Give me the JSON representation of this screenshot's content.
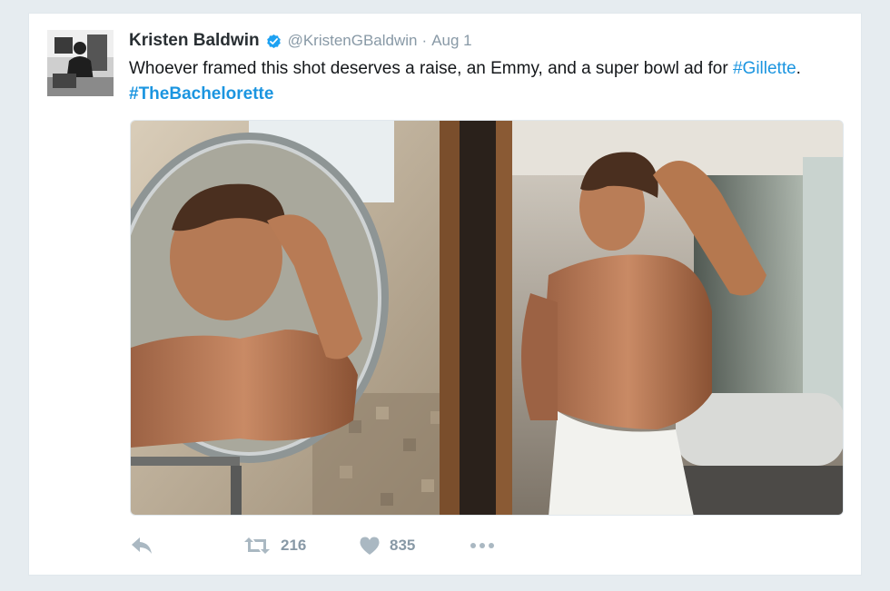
{
  "tweet": {
    "author_name": "Kristen Baldwin",
    "handle": "@KristenGBaldwin",
    "separator": "·",
    "date": "Aug 1",
    "text_before": "Whoever framed this shot deserves a raise, an Emmy, and a super bowl ad for ",
    "hashtag1": "#Gillette",
    "text_between": ". ",
    "hashtag2": "#TheBachelorette",
    "retweet_count": "216",
    "like_count": "835"
  },
  "icons": {
    "verified": "verified-badge-icon",
    "reply": "reply-icon",
    "retweet": "retweet-icon",
    "like": "heart-icon",
    "more": "more-icon"
  },
  "colors": {
    "hashtag": "#1b95e0",
    "verified": "#1da1f2",
    "action_icon": "#aab8c2",
    "background": "#e6ecf0"
  }
}
